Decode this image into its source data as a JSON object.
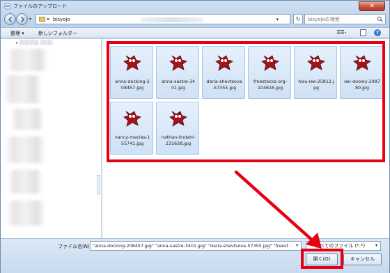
{
  "window": {
    "title": "ファイルのアップロード",
    "close_label": "✕"
  },
  "nav": {
    "address_path": "bisyojo",
    "search_placeholder": "bisyojoの検索"
  },
  "toolbar": {
    "organize_label": "整理 ▾",
    "new_folder_label": "新しいフォルダー"
  },
  "files": [
    {
      "name": "anna-docking-208457.jpg",
      "display": "anna-docking-2\n08457.jpg"
    },
    {
      "name": "anna-sastre-3401.jpg",
      "display": "anna-sastre-34\n01.jpg"
    },
    {
      "name": "daria-shevtsova-57355.jpg",
      "display": "daria-shevtsova\n-57355.jpg"
    },
    {
      "name": "freestocks-org-104616.jpg",
      "display": "freestocks-org-\n104616.jpg"
    },
    {
      "name": "hisu-lee-25812.jpg",
      "display": "hisu-lee-25812.j\npg"
    },
    {
      "name": "ian-dooley-298780.jpg",
      "display": "ian-dooley-2987\n80.jpg"
    },
    {
      "name": "nancy-macias-155741.jpg",
      "display": "nancy-macias-1\n55741.jpg"
    },
    {
      "name": "nathan-lindahl-231628.jpg",
      "display": "nathan-lindahl-\n231628.jpg"
    }
  ],
  "bottom": {
    "filename_label": "ファイル名(N):",
    "filename_value": "\"anna-docking-208457.jpg\" \"anna-sastre-3401.jpg\" \"daria-shevtsova-57355.jpg\" \"freest",
    "filetype_value": "すべてのファイル (*.*)",
    "open_label": "開く(O)",
    "cancel_label": "キャンセル"
  },
  "colors": {
    "highlight": "#e60012",
    "selection_bg": "#cfe1f6",
    "window_chrome": "#b9d1ea"
  }
}
